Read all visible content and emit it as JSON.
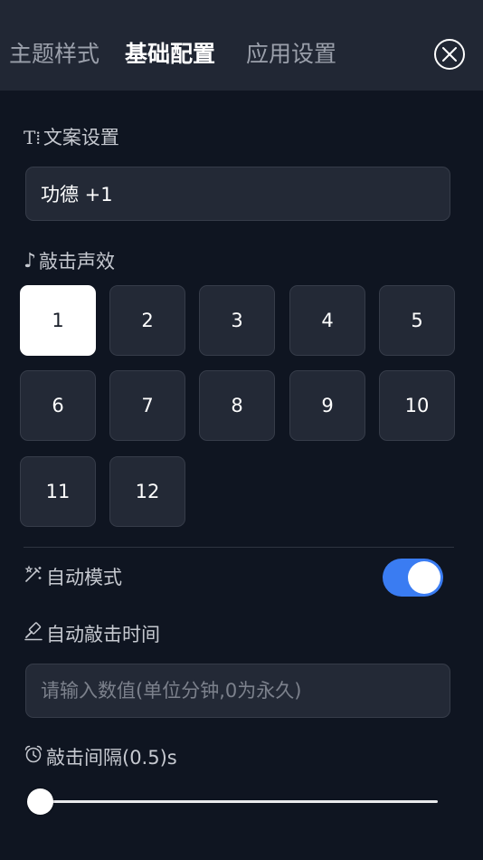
{
  "tabs": [
    {
      "label": "主题样式",
      "active": false
    },
    {
      "label": "基础配置",
      "active": true
    },
    {
      "label": "应用设置",
      "active": false
    }
  ],
  "close_icon": "close-circle-icon",
  "text_section": {
    "icon_glyph": "T⁞",
    "icon": "text-icon",
    "label": "文案设置",
    "value": "功德 +1"
  },
  "sound_section": {
    "icon_glyph": "♪",
    "icon": "music-note-icon",
    "label": "敲击声效",
    "options": [
      "1",
      "2",
      "3",
      "4",
      "5",
      "6",
      "7",
      "8",
      "9",
      "10",
      "11",
      "12"
    ],
    "selected": "1"
  },
  "auto_mode": {
    "icon": "magic-wand-icon",
    "label": "自动模式",
    "enabled": true,
    "accent": "#3a7cf2"
  },
  "auto_time": {
    "icon": "gavel-icon",
    "label": "自动敲击时间",
    "value": "",
    "placeholder": "请输入数值(单位分钟,0为永久)"
  },
  "interval": {
    "icon": "alarm-clock-icon",
    "label": "敲击间隔(0.5)s",
    "value": 0.5,
    "fraction": 0
  }
}
